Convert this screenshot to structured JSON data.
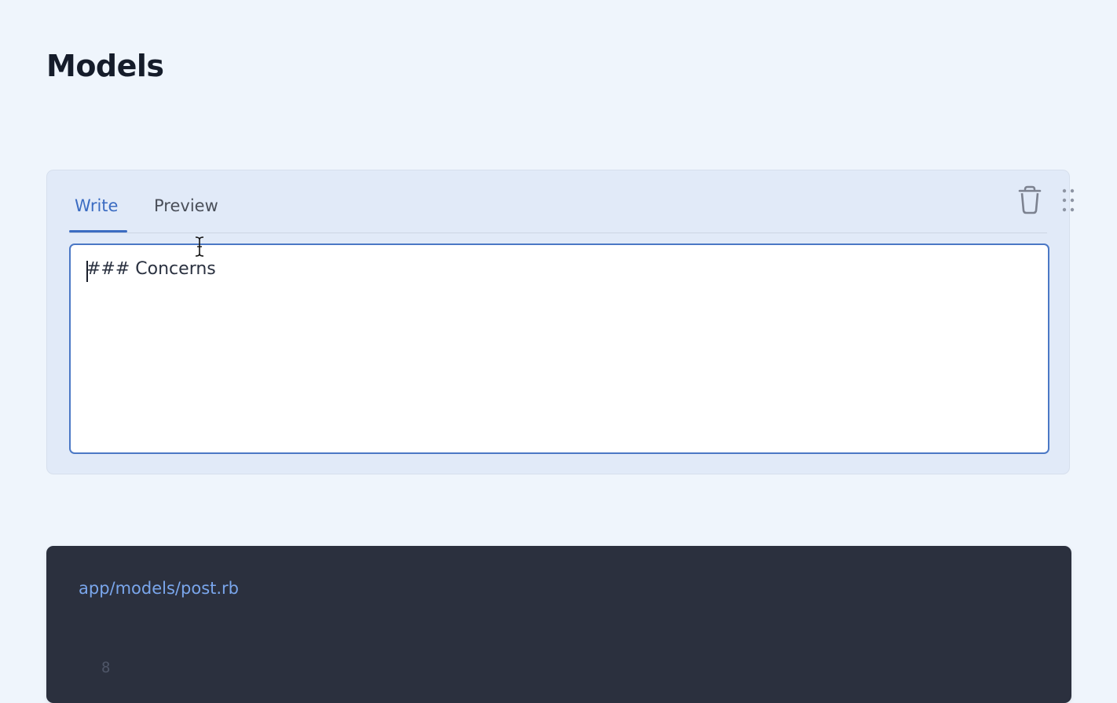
{
  "page": {
    "title": "Models"
  },
  "editor": {
    "tabs": [
      {
        "label": "Write",
        "active": true
      },
      {
        "label": "Preview",
        "active": false
      }
    ],
    "textarea_value": "### Concerns",
    "icons": {
      "delete": "trash-icon",
      "drag": "drag-handle-icon"
    }
  },
  "code_block": {
    "filename": "app/models/post.rb",
    "visible_line_number": "8"
  },
  "colors": {
    "background": "#eff5fc",
    "accent": "#3b6cc2",
    "card": "#e1eaf8",
    "code_background": "#2b303e",
    "filename": "#7aa6ec"
  }
}
